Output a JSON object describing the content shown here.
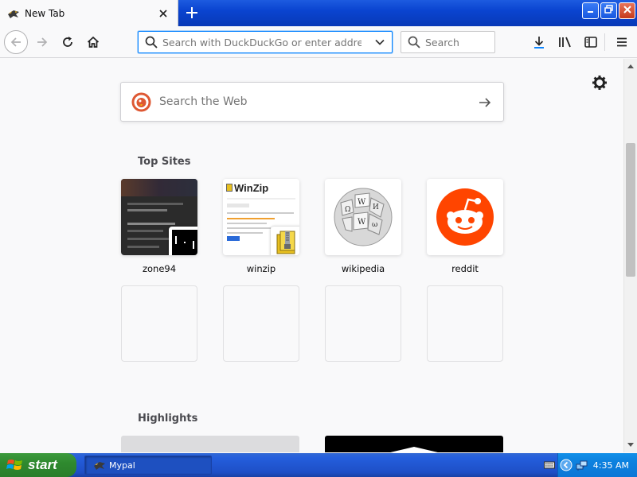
{
  "tab": {
    "title": "New Tab",
    "favicon": "mypal-bird-icon"
  },
  "toolbar": {
    "url_placeholder": "Search with DuckDuckGo or enter address",
    "search_placeholder": "Search"
  },
  "newtab": {
    "search_placeholder": "Search the Web",
    "top_sites_heading": "Top Sites",
    "highlights_heading": "Highlights",
    "top_sites": [
      {
        "label": "zone94"
      },
      {
        "label": "winzip"
      },
      {
        "label": "wikipedia"
      },
      {
        "label": "reddit"
      }
    ],
    "winzip_logo": "WinZip"
  },
  "taskbar": {
    "start_label": "start",
    "task_label": "Mypal",
    "clock": "4:35 AM"
  },
  "colors": {
    "accent": "#0a84ff",
    "reddit": "#ff4500",
    "ddg": "#de5833",
    "taskbar": "#245edc",
    "start": "#2f8a2f"
  }
}
